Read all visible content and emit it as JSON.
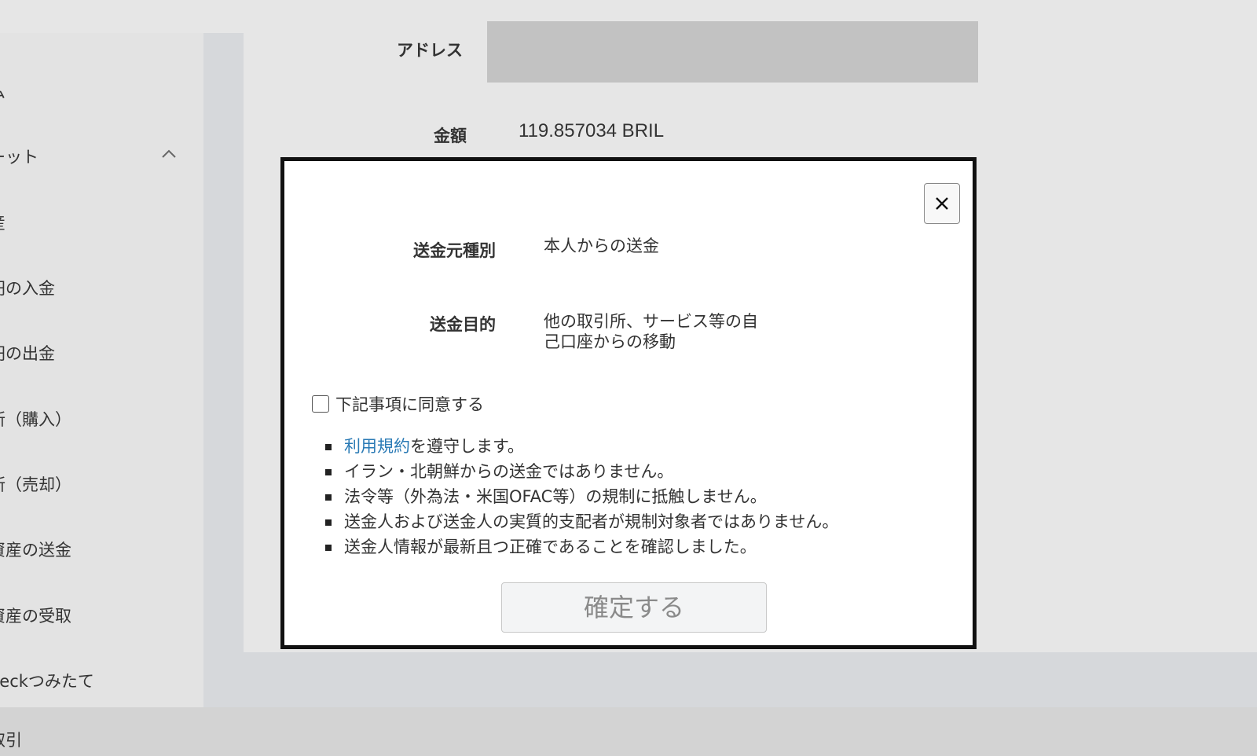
{
  "sidebar": {
    "items": [
      {
        "label": "ム"
      },
      {
        "label": "ーット"
      },
      {
        "label": "産"
      },
      {
        "label": "円の入金"
      },
      {
        "label": "円の出金"
      },
      {
        "label": "所（購入）"
      },
      {
        "label": "所（売却）"
      },
      {
        "label": "資産の送金"
      },
      {
        "label": "資産の受取"
      },
      {
        "label": "heckつみたて"
      },
      {
        "label": "取引"
      }
    ],
    "expand_icon": "chevron-up-icon"
  },
  "form": {
    "address_label": "アドレス",
    "address_value": "",
    "amount_label": "金額",
    "amount_value": "119.857034 BRIL"
  },
  "modal": {
    "close_icon": "close-icon",
    "sender_type_label": "送金元種別",
    "sender_type_value": "本人からの送金",
    "purpose_label": "送金目的",
    "purpose_value_line1": "他の取引所、サービス等の自",
    "purpose_value_line2": "己口座からの移動",
    "agree_label": "下記事項に同意する",
    "agree_checked": false,
    "notes": {
      "terms_link": "利用規約",
      "terms_suffix": "を遵守します。",
      "item2": "イラン・北朝鮮からの送金ではありません。",
      "item3": "法令等（外為法・米国OFAC等）の規制に抵触しません。",
      "item4": "送金人および送金人の実質的支配者が規制対象者ではありません。",
      "item5": "送金人情報が最新且つ正確であることを確認しました。"
    },
    "confirm_label": "確定する"
  }
}
